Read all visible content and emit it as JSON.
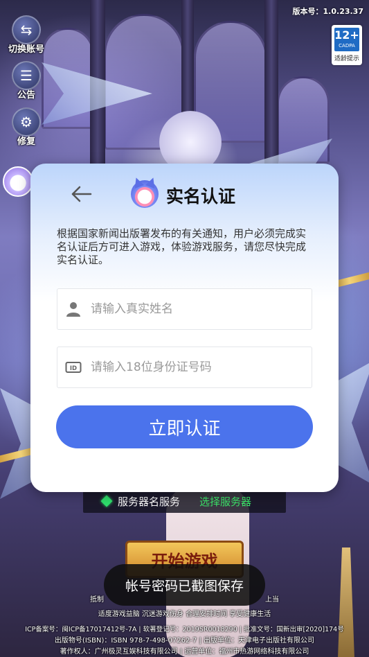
{
  "version": {
    "label": "版本号：1.0.23.37"
  },
  "age_rating": {
    "age": "12+",
    "org": "CADPA",
    "tip": "适龄提示"
  },
  "side_tools": [
    {
      "label": "切换账号",
      "icon": "switch-account-icon"
    },
    {
      "label": "公告",
      "icon": "notice-icon"
    },
    {
      "label": "修复",
      "icon": "repair-icon"
    }
  ],
  "dialog": {
    "title": "实名认证",
    "description": "根据国家新闻出版署发布的有关通知，用户必须完成实名认证后方可进入游戏，体验游戏服务，请您尽快完成实名认证。",
    "name_field": {
      "placeholder": "请输入真实姓名",
      "value": "",
      "icon": "person-icon"
    },
    "id_field": {
      "placeholder": "请输入18位身份证号码",
      "value": "",
      "icon": "id-card-icon"
    },
    "submit_label": "立即认证",
    "back_icon": "back-arrow-icon",
    "brand_color": "#4b73ec"
  },
  "server": {
    "name": "服务器名服务",
    "select_label": "选择服务器"
  },
  "start_button": "开始游戏",
  "toast": "帐号密码已截图保存",
  "footer": {
    "line1": "抵制",
    "line1_right": "上当",
    "line2": "适度游戏益脑 沉迷游戏伤身 合理安排时间 享受健康生活",
    "line3": "ICP备案号：闽ICP备17017412号-7A | 软著登记号：2019SR0018290 | 批准文号：国新出审[2020]174号",
    "line4": "出版物号(ISBN)：ISBN 978-7-498-07262-7 | 出版单位：天津电子出版社有限公司",
    "line5": "著作权人：广州极灵互娱科技有限公司 | 运营单位：福州市热游网络科技有限公司"
  }
}
